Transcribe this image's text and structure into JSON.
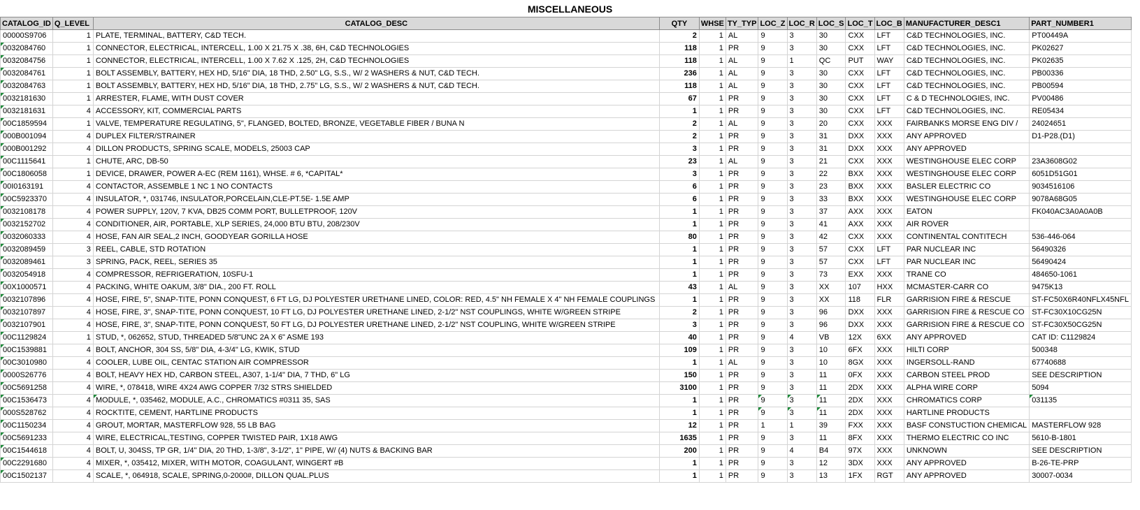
{
  "sheet_title": "MISCELLANEOUS",
  "colors": {
    "header_bg": "#d9d9d9",
    "grid": "#d4d4d4",
    "comment_flag": "#1e8a3a"
  },
  "columns": [
    "CATALOG_ID",
    "Q_LEVEL",
    "CATALOG_DESC",
    "QTY",
    "WHSE",
    "TY_TYP",
    "LOC_Z",
    "LOC_R",
    "LOC_S",
    "LOC_T",
    "LOC_B",
    "MANUFACTURER_DESC1",
    "PART_NUMBER1"
  ],
  "rows": [
    [
      "00000S9706",
      "1",
      "PLATE, TERMINAL, BATTERY, C&D TECH.",
      "2",
      "1",
      "AL",
      "9",
      "3",
      "30",
      "CXX",
      "LFT",
      "C&D TECHNOLOGIES, INC.",
      "PT00449A"
    ],
    [
      "0032084760",
      "1",
      "CONNECTOR, ELECTRICAL, INTERCELL, 1.00 X 21.75 X .38, 6H, C&D TECHNOLOGIES",
      "118",
      "1",
      "PR",
      "9",
      "3",
      "30",
      "CXX",
      "LFT",
      "C&D TECHNOLOGIES, INC.",
      "PK02627"
    ],
    [
      "0032084756",
      "1",
      "CONNECTOR, ELECTRICAL, INTERCELL, 1.00 X 7.62 X .125, 2H, C&D TECHNOLOGIES",
      "118",
      "1",
      "AL",
      "9",
      "1",
      "QC",
      "PUT",
      "WAY",
      "C&D TECHNOLOGIES, INC.",
      "PK02635"
    ],
    [
      "0032084761",
      "1",
      "BOLT ASSEMBLY, BATTERY, HEX HD, 5/16\" DIA, 18 THD, 2.50\" LG, S.S., W/ 2 WASHERS & NUT, C&D TECH.",
      "236",
      "1",
      "AL",
      "9",
      "3",
      "30",
      "CXX",
      "LFT",
      "C&D TECHNOLOGIES, INC.",
      "PB00336"
    ],
    [
      "0032084763",
      "1",
      "BOLT ASSEMBLY, BATTERY, HEX HD, 5/16\" DIA, 18 THD, 2.75\" LG, S.S., W/ 2 WASHERS & NUT, C&D TECH.",
      "118",
      "1",
      "AL",
      "9",
      "3",
      "30",
      "CXX",
      "LFT",
      "C&D TECHNOLOGIES, INC.",
      "PB00594"
    ],
    [
      "0032181630",
      "1",
      "ARRESTER, FLAME, WITH DUST COVER",
      "67",
      "1",
      "PR",
      "9",
      "3",
      "30",
      "CXX",
      "LFT",
      "C & D TECHNOLOGIES, INC.",
      "PV00486"
    ],
    [
      "0032181631",
      "4",
      "ACCESSORY, KIT, COMMERCIAL PARTS",
      "1",
      "1",
      "PR",
      "9",
      "3",
      "30",
      "CXX",
      "LFT",
      "C&D TECHNOLOGIES, INC.",
      "RE05434"
    ],
    [
      "00C1859594",
      "1",
      "VALVE, TEMPERATURE REGULATING, 5\", FLANGED, BOLTED, BRONZE, VEGETABLE FIBER / BUNA N",
      "2",
      "1",
      "AL",
      "9",
      "3",
      "20",
      "CXX",
      "XXX",
      "FAIRBANKS MORSE ENG DIV /",
      "24024651"
    ],
    [
      "000B001094",
      "4",
      "DUPLEX FILTER/STRAINER",
      "2",
      "1",
      "PR",
      "9",
      "3",
      "31",
      "DXX",
      "XXX",
      "ANY APPROVED",
      "D1-P28.(D1)"
    ],
    [
      "000B001292",
      "4",
      "DILLON PRODUCTS, SPRING SCALE, MODELS, 25003 CAP",
      "3",
      "1",
      "PR",
      "9",
      "3",
      "31",
      "DXX",
      "XXX",
      "ANY APPROVED",
      ""
    ],
    [
      "00C1115641",
      "1",
      "CHUTE, ARC, DB-50",
      "23",
      "1",
      "AL",
      "9",
      "3",
      "21",
      "CXX",
      "XXX",
      "WESTINGHOUSE ELEC CORP",
      "23A3608G02"
    ],
    [
      "00C1806058",
      "1",
      "DEVICE, DRAWER, POWER A-EC (REM 1161), WHSE. # 6, *CAPITAL*",
      "3",
      "1",
      "PR",
      "9",
      "3",
      "22",
      "BXX",
      "XXX",
      "WESTINGHOUSE ELEC CORP",
      "6051D51G01"
    ],
    [
      "00I0163191",
      "4",
      "CONTACTOR, ASSEMBLE 1 NC 1 NO CONTACTS",
      "6",
      "1",
      "PR",
      "9",
      "3",
      "23",
      "BXX",
      "XXX",
      "BASLER ELECTRIC CO",
      "9034516106"
    ],
    [
      "00C5923370",
      "4",
      "INSULATOR, *, 031746, INSULATOR,PORCELAIN,CLE-PT.5E- 1.5E AMP",
      "6",
      "1",
      "PR",
      "9",
      "3",
      "33",
      "BXX",
      "XXX",
      "WESTINGHOUSE ELEC CORP",
      "9078A68G05"
    ],
    [
      "0032108178",
      "4",
      "POWER SUPPLY, 120V, 7 KVA, DB25 COMM PORT, BULLETPROOF, 120V",
      "1",
      "1",
      "PR",
      "9",
      "3",
      "37",
      "AXX",
      "XXX",
      "EATON",
      "FK040AC3A0A0A0B"
    ],
    [
      "0032152702",
      "4",
      "CONDITIONER, AIR, PORTABLE, XLP SERIES, 24,000 BTU BTU, 208/230V",
      "1",
      "1",
      "PR",
      "9",
      "3",
      "41",
      "AXX",
      "XXX",
      "AIR ROVER",
      ""
    ],
    [
      "0032060333",
      "4",
      "HOSE, FAN AIR SEAL,2 INCH, GOODYEAR GORILLA HOSE",
      "80",
      "1",
      "PR",
      "9",
      "3",
      "42",
      "CXX",
      "XXX",
      "CONTINENTAL CONTITECH",
      "536-446-064"
    ],
    [
      "0032089459",
      "3",
      "REEL, CABLE, STD ROTATION",
      "1",
      "1",
      "PR",
      "9",
      "3",
      "57",
      "CXX",
      "LFT",
      "PAR NUCLEAR INC",
      "56490326"
    ],
    [
      "0032089461",
      "3",
      "SPRING, PACK, REEL, SERIES 35",
      "1",
      "1",
      "PR",
      "9",
      "3",
      "57",
      "CXX",
      "LFT",
      "PAR NUCLEAR INC",
      "56490424"
    ],
    [
      "0032054918",
      "4",
      "COMPRESSOR, REFRIGERATION, 10SFU-1",
      "1",
      "1",
      "PR",
      "9",
      "3",
      "73",
      "EXX",
      "XXX",
      "TRANE CO",
      "484650-1061"
    ],
    [
      "00X1000571",
      "4",
      "PACKING, WHITE OAKUM, 3/8\" DIA., 200 FT. ROLL",
      "43",
      "1",
      "AL",
      "9",
      "3",
      "XX",
      "107",
      "HXX",
      "MCMASTER-CARR CO",
      "9475K13"
    ],
    [
      "0032107896",
      "4",
      "HOSE, FIRE, 5\", SNAP-TITE, PONN CONQUEST, 6 FT LG, DJ POLYESTER URETHANE LINED, COLOR: RED, 4.5\" NH FEMALE X 4\" NH FEMALE COUPLINGS",
      "1",
      "1",
      "PR",
      "9",
      "3",
      "XX",
      "118",
      "FLR",
      "GARRISION FIRE & RESCUE",
      "ST-FC50X6R40NFLX45NFL"
    ],
    [
      "0032107897",
      "4",
      "HOSE, FIRE, 3\", SNAP-TITE, PONN CONQUEST, 10 FT LG, DJ POLYESTER URETHANE LINED, 2-1/2\" NST COUPLINGS, WHITE W/GREEN STRIPE",
      "2",
      "1",
      "PR",
      "9",
      "3",
      "96",
      "DXX",
      "XXX",
      "GARRISION FIRE & RESCUE CO",
      "ST-FC30X10CG25N"
    ],
    [
      "0032107901",
      "4",
      "HOSE, FIRE, 3\", SNAP-TITE, PONN CONQUEST, 50 FT LG, DJ POLYESTER URETHANE LINED, 2-1/2\" NST COUPLING, WHITE W/GREEN STRIPE",
      "3",
      "1",
      "PR",
      "9",
      "3",
      "96",
      "DXX",
      "XXX",
      "GARRISION FIRE & RESCUE CO",
      "ST-FC30X50CG25N"
    ],
    [
      "00C1129824",
      "1",
      "STUD, *, 062652, STUD, THREADED 5/8\"UNC 2A X 6\" ASME 193",
      "40",
      "1",
      "PR",
      "9",
      "4",
      "VB",
      "12X",
      "6XX",
      "ANY APPROVED",
      "CAT ID: C1129824"
    ],
    [
      "00C1539881",
      "4",
      "BOLT, ANCHOR, 304 SS, 5/8\" DIA, 4-3/4\" LG, KWIK, STUD",
      "109",
      "1",
      "PR",
      "9",
      "3",
      "10",
      "6FX",
      "XXX",
      "HILTI CORP",
      "500348"
    ],
    [
      "00C3010980",
      "4",
      "COOLER, LUBE OIL, CENTAC STATION AIR COMPRESSOR",
      "1",
      "1",
      "AL",
      "9",
      "3",
      "10",
      "8GX",
      "XXX",
      "INGERSOLL-RAND",
      "67740688"
    ],
    [
      "0000S26776",
      "4",
      "BOLT, HEAVY HEX HD, CARBON STEEL, A307, 1-1/4\" DIA, 7 THD, 6\" LG",
      "150",
      "1",
      "PR",
      "9",
      "3",
      "11",
      "0FX",
      "XXX",
      "CARBON STEEL PROD",
      "SEE DESCRIPTION"
    ],
    [
      "00C5691258",
      "4",
      "WIRE, *, 078418, WIRE 4X24 AWG COPPER 7/32 STRS SHIELDED",
      "3100",
      "1",
      "PR",
      "9",
      "3",
      "11",
      "2DX",
      "XXX",
      "ALPHA WIRE CORP",
      "5094"
    ],
    [
      "00C1536473",
      "4",
      "MODULE, *, 035462, MODULE, A.C., CHROMATICS #0311 35, SAS",
      "1",
      "1",
      "PR",
      "9",
      "3",
      "11",
      "2DX",
      "XXX",
      "CHROMATICS CORP",
      "031135"
    ],
    [
      "000S528762",
      "4",
      "ROCKTITE, CEMENT, HARTLINE PRODUCTS",
      "1",
      "1",
      "PR",
      "9",
      "3",
      "11",
      "2DX",
      "XXX",
      "HARTLINE PRODUCTS",
      ""
    ],
    [
      "00C1150234",
      "4",
      "GROUT, MORTAR, MASTERFLOW 928, 55 LB BAG",
      "12",
      "1",
      "PR",
      "1",
      "1",
      "39",
      "FXX",
      "XXX",
      "BASF CONSTUCTION CHEMICAL",
      "MASTERFLOW 928"
    ],
    [
      "00C5691233",
      "4",
      "WIRE, ELECTRICAL,TESTING, COPPER TWISTED PAIR, 1X18 AWG",
      "1635",
      "1",
      "PR",
      "9",
      "3",
      "11",
      "8FX",
      "XXX",
      "THERMO ELECTRIC CO INC",
      "5610-B-1801"
    ],
    [
      "00C1544618",
      "4",
      "BOLT, U, 304SS, TP GR, 1/4\" DIA, 20 THD, 1-3/8\", 3-1/2\", 1\" PIPE, W/ (4) NUTS & BACKING BAR",
      "200",
      "1",
      "PR",
      "9",
      "4",
      "B4",
      "97X",
      "XXX",
      "UNKNOWN",
      "SEE DESCRIPTION"
    ],
    [
      "00C2291680",
      "4",
      "MIXER, *, 035412, MIXER, WITH MOTOR, COAGULANT, WINGERT #B",
      "1",
      "1",
      "PR",
      "9",
      "3",
      "12",
      "3DX",
      "XXX",
      "ANY APPROVED",
      "B-26-TE-PRP"
    ],
    [
      "00C1502137",
      "4",
      "SCALE, *, 064918, SCALE, SPRING,0-2000#, DILLON QUAL.PLUS",
      "1",
      "1",
      "PR",
      "9",
      "3",
      "13",
      "1FX",
      "RGT",
      "ANY APPROVED",
      "30007-0034"
    ]
  ],
  "flagged_cells": [
    [
      1,
      0
    ],
    [
      2,
      0
    ],
    [
      3,
      0
    ],
    [
      4,
      0
    ],
    [
      5,
      0
    ],
    [
      6,
      0
    ],
    [
      7,
      0
    ],
    [
      8,
      0
    ],
    [
      9,
      0
    ],
    [
      10,
      0
    ],
    [
      11,
      0
    ],
    [
      12,
      0
    ],
    [
      13,
      0
    ],
    [
      14,
      0
    ],
    [
      15,
      0
    ],
    [
      16,
      0
    ],
    [
      17,
      0
    ],
    [
      18,
      0
    ],
    [
      19,
      0
    ],
    [
      20,
      0
    ],
    [
      21,
      0
    ],
    [
      22,
      0
    ],
    [
      23,
      0
    ],
    [
      24,
      0
    ],
    [
      25,
      0
    ],
    [
      26,
      0
    ],
    [
      27,
      0
    ],
    [
      28,
      0
    ],
    [
      29,
      0
    ],
    [
      30,
      0
    ],
    [
      31,
      0
    ],
    [
      32,
      0
    ],
    [
      33,
      0
    ],
    [
      34,
      0
    ],
    [
      35,
      0
    ],
    [
      29,
      2
    ],
    [
      29,
      6
    ],
    [
      29,
      7
    ],
    [
      29,
      8
    ],
    [
      29,
      12
    ],
    [
      30,
      6
    ],
    [
      30,
      7
    ],
    [
      30,
      8
    ]
  ]
}
